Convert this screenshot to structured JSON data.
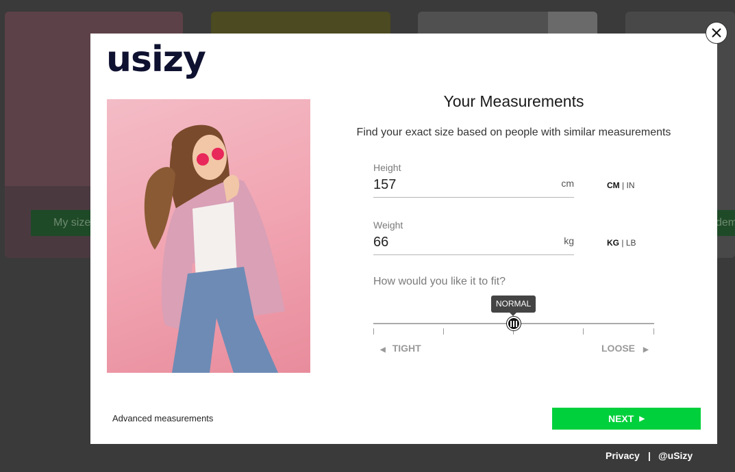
{
  "background": {
    "left_button_label": "My size",
    "right_button_label": "dem"
  },
  "brand": {
    "logo_text": "usizy"
  },
  "modal": {
    "title": "Your Measurements",
    "subtitle": "Find your exact size based on people with similar measurements",
    "height": {
      "label": "Height",
      "value": "157",
      "unit": "cm",
      "toggle_active": "CM",
      "toggle_sep": "|",
      "toggle_inactive": "IN"
    },
    "weight": {
      "label": "Weight",
      "value": "66",
      "unit": "kg",
      "toggle_active": "KG",
      "toggle_sep": "|",
      "toggle_inactive": "LB"
    },
    "fit": {
      "question": "How would you like it to fit?",
      "selected": "NORMAL",
      "min_label": "TIGHT",
      "max_label": "LOOSE",
      "position_fraction": 0.5
    },
    "advanced_link": "Advanced measurements",
    "next_label": "NEXT"
  },
  "footer": {
    "privacy": "Privacy",
    "separator": "|",
    "handle": "@uSizy"
  },
  "colors": {
    "accent_green": "#00d03c",
    "brand_navy": "#0f1130",
    "overlay": "#3a3a3a"
  }
}
